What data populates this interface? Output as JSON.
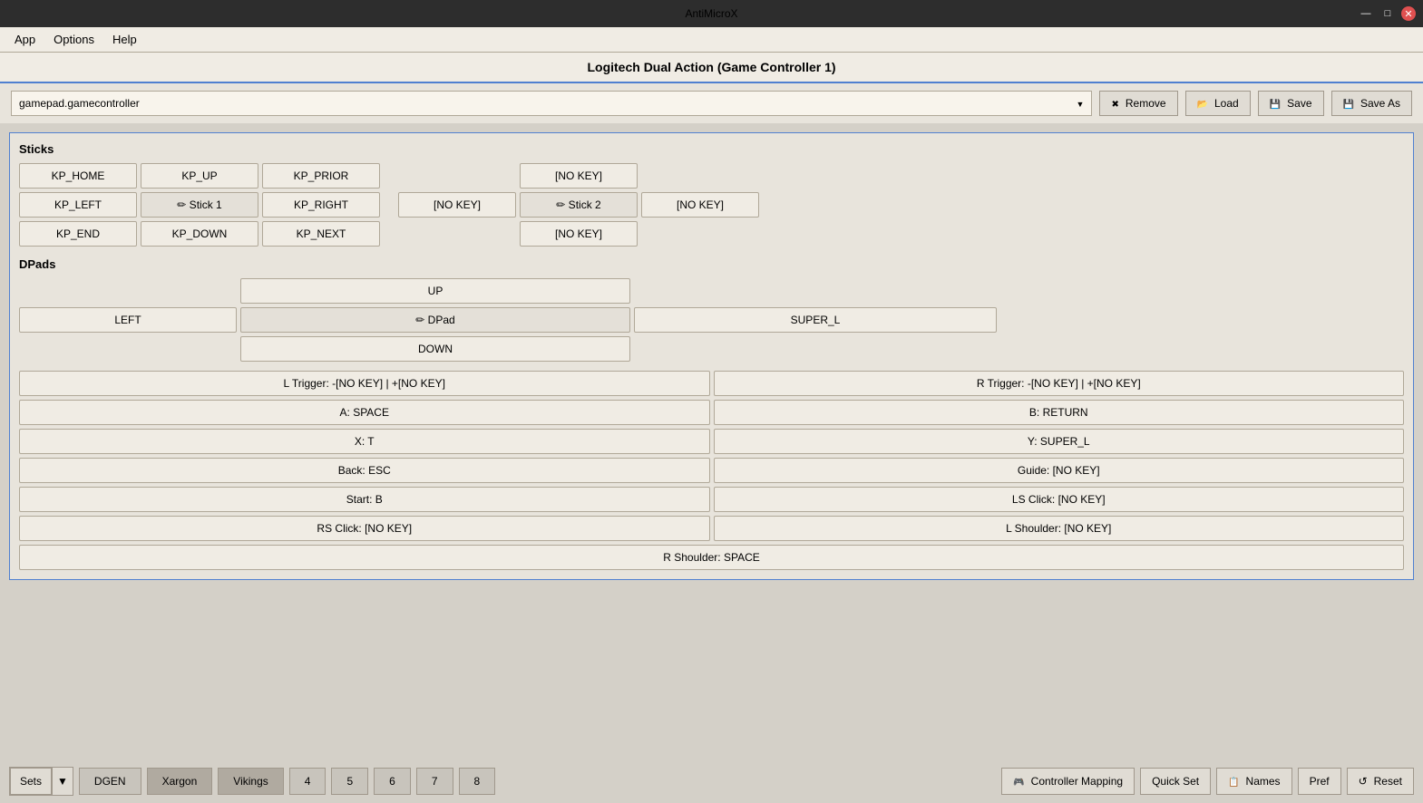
{
  "titlebar": {
    "title": "AntiMicroX",
    "min_label": "—",
    "max_label": "□",
    "close_label": "✕"
  },
  "menubar": {
    "items": [
      "App",
      "Options",
      "Help"
    ]
  },
  "controller_header": {
    "title": "Logitech Dual Action (Game Controller 1)"
  },
  "profile": {
    "current": "gamepad.gamecontroller",
    "remove_label": "Remove",
    "load_label": "Load",
    "save_label": "Save",
    "save_as_label": "Save As"
  },
  "sections": {
    "sticks_label": "Sticks",
    "dpads_label": "DPads"
  },
  "sticks": {
    "left": [
      {
        "row": 0,
        "col": 0,
        "label": "KP_HOME"
      },
      {
        "row": 0,
        "col": 1,
        "label": "KP_UP"
      },
      {
        "row": 0,
        "col": 2,
        "label": "KP_PRIOR"
      },
      {
        "row": 1,
        "col": 0,
        "label": "KP_LEFT"
      },
      {
        "row": 1,
        "col": 1,
        "label": "✏ Stick 1"
      },
      {
        "row": 1,
        "col": 2,
        "label": "KP_RIGHT"
      },
      {
        "row": 2,
        "col": 0,
        "label": "KP_END"
      },
      {
        "row": 2,
        "col": 1,
        "label": "KP_DOWN"
      },
      {
        "row": 2,
        "col": 2,
        "label": "KP_NEXT"
      }
    ],
    "right": [
      {
        "row": 0,
        "col": 0,
        "label": "[NO KEY]"
      },
      {
        "row": 1,
        "col": 0,
        "label": "[NO KEY]"
      },
      {
        "row": 1,
        "col": 1,
        "label": "✏ Stick 2"
      },
      {
        "row": 1,
        "col": 2,
        "label": "[NO KEY]"
      },
      {
        "row": 2,
        "col": 0,
        "label": "[NO KEY]"
      }
    ]
  },
  "dpad": {
    "up": "UP",
    "left": "LEFT",
    "center": "✏ DPad",
    "right": "SUPER_L",
    "down": "DOWN"
  },
  "buttons": [
    {
      "left": "L Trigger: -[NO KEY] | +[NO KEY]",
      "right": "R Trigger: -[NO KEY] | +[NO KEY]"
    },
    {
      "left": "A: SPACE",
      "right": "B: RETURN"
    },
    {
      "left": "X: T",
      "right": "Y: SUPER_L"
    },
    {
      "left": "Back: ESC",
      "right": "Guide: [NO KEY]"
    },
    {
      "left": "Start: B",
      "right": "LS Click: [NO KEY]"
    },
    {
      "left": "RS Click: [NO KEY]",
      "right": "L Shoulder: [NO KEY]"
    },
    {
      "single": "R Shoulder: SPACE"
    }
  ],
  "bottom_tabs": {
    "sets_label": "Sets",
    "tabs": [
      "DGEN",
      "Xargon",
      "Vikings",
      "4",
      "5",
      "6",
      "7",
      "8"
    ]
  },
  "bottom_buttons": {
    "controller_mapping": "Controller Mapping",
    "quick_set": "Quick Set",
    "names": "Names",
    "pref": "Pref",
    "reset": "Reset"
  }
}
